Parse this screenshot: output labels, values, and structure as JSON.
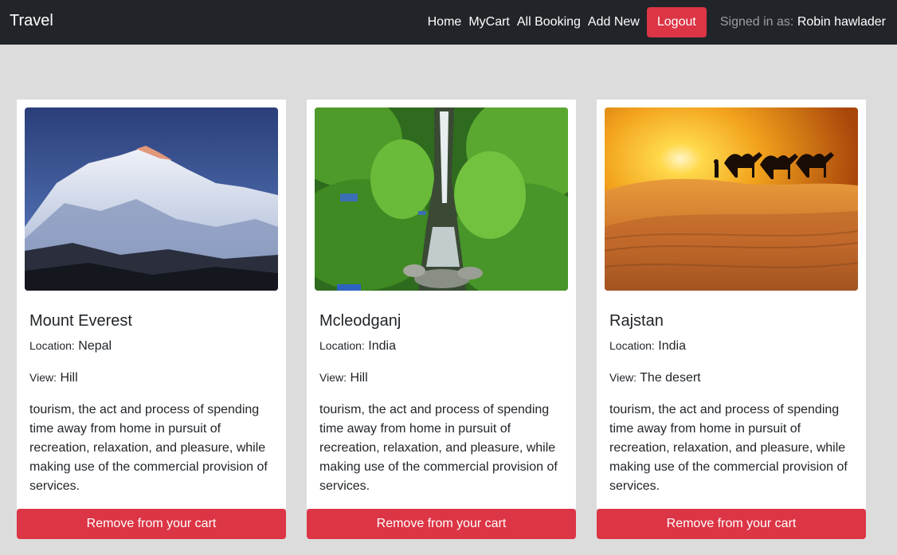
{
  "navbar": {
    "brand": "Travel",
    "links": [
      "Home",
      "MyCart",
      "All Booking",
      "Add New"
    ],
    "logout_label": "Logout",
    "signed_in_prefix": "Signed in as:",
    "user_name": "Robin hawlader"
  },
  "cards": [
    {
      "title": "Mount Everest",
      "location_label": "Location:",
      "location": "Nepal",
      "view_label": "View:",
      "view": "Hill",
      "description": "tourism, the act and process of spending time away from home in pursuit of recreation, relaxation, and pleasure, while making use of the commercial provision of services.",
      "button_label": "Remove from your cart"
    },
    {
      "title": "Mcleodganj",
      "location_label": "Location:",
      "location": "India",
      "view_label": "View:",
      "view": "Hill",
      "description": "tourism, the act and process of spending time away from home in pursuit of recreation, relaxation, and pleasure, while making use of the commercial provision of services.",
      "button_label": "Remove from your cart"
    },
    {
      "title": "Rajstan",
      "location_label": "Location:",
      "location": "India",
      "view_label": "View:",
      "view": "The desert",
      "description": "tourism, the act and process of spending time away from home in pursuit of recreation, relaxation, and pleasure, while making use of the commercial provision of services.",
      "button_label": "Remove from your cart"
    }
  ],
  "colors": {
    "navbar_bg": "#212529",
    "page_bg": "#dcdcdc",
    "danger": "#dc3545"
  }
}
